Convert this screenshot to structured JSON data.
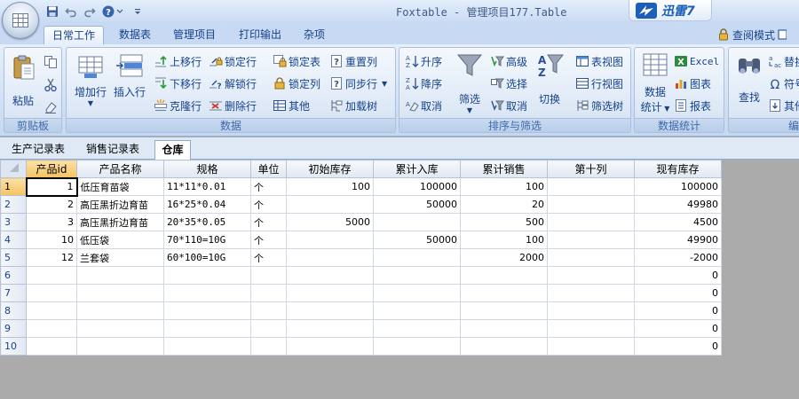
{
  "window": {
    "title": "Foxtable - 管理项目177.Table"
  },
  "brand": {
    "name": "迅雷7"
  },
  "quick_access": [
    {
      "icon": "save-icon"
    },
    {
      "icon": "undo-icon"
    },
    {
      "icon": "redo-icon"
    },
    {
      "icon": "help-icon"
    },
    {
      "icon": "customize-dropdown-icon"
    }
  ],
  "ribbon_tabs": [
    {
      "label": "日常工作",
      "active": true
    },
    {
      "label": "数据表"
    },
    {
      "label": "管理项目"
    },
    {
      "label": "打印输出"
    },
    {
      "label": "杂项"
    }
  ],
  "view_mode": {
    "label": "查阅模式"
  },
  "groups": {
    "clipboard": {
      "label": "剪贴板",
      "paste": "粘贴"
    },
    "data": {
      "label": "数据",
      "add_row": "增加行",
      "insert_row": "插入行",
      "move_up": "上移行",
      "move_down": "下移行",
      "clone_row": "克隆行",
      "lock_row": "锁定行",
      "unlock_row": "解锁行",
      "delete_row": "删除行",
      "lock_table": "锁定表",
      "lock_column": "锁定列",
      "other": "其他",
      "reset_column": "重置列",
      "sync_row": "同步行",
      "load_tree": "加载树"
    },
    "sort_filter": {
      "label": "排序与筛选",
      "asc": "升序",
      "desc": "降序",
      "cancel_sort": "取消",
      "filter": "筛选",
      "advanced": "高级",
      "select": "选择",
      "cancel_filter": "取消",
      "switch": "切换",
      "table_view": "表视图",
      "row_view": "行视图",
      "filter_tree": "筛选树"
    },
    "statistics": {
      "label": "数据统计",
      "data_stats_line1": "数据",
      "data_stats_line2": "统计",
      "excel": "Excel",
      "chart": "图表",
      "report": "报表"
    },
    "edit": {
      "label": "编辑",
      "find": "查找",
      "replace": "替换",
      "symbol": "符号",
      "other": "其他"
    }
  },
  "sheet_tabs": [
    {
      "label": "生产记录表"
    },
    {
      "label": "销售记录表"
    },
    {
      "label": "仓库",
      "active": true
    }
  ],
  "table": {
    "columns": [
      "产品id",
      "产品名称",
      "规格",
      "单位",
      "初始库存",
      "累计入库",
      "累计销售",
      "第十列",
      "现有库存"
    ],
    "rows": [
      {
        "num": "1",
        "cells": [
          "1",
          "低压育苗袋",
          "11*11*0.01",
          "个",
          "100",
          "100000",
          "100",
          "",
          "100000"
        ]
      },
      {
        "num": "2",
        "cells": [
          "2",
          "高压黑折边育苗",
          "16*25*0.04",
          "个",
          "",
          "50000",
          "20",
          "",
          "49980"
        ]
      },
      {
        "num": "3",
        "cells": [
          "3",
          "高压黑折边育苗",
          "20*35*0.05",
          "个",
          "5000",
          "",
          "500",
          "",
          "4500"
        ]
      },
      {
        "num": "4",
        "cells": [
          "10",
          "低压袋",
          "70*110=10G",
          "个",
          "",
          "50000",
          "100",
          "",
          "49900"
        ]
      },
      {
        "num": "5",
        "cells": [
          "12",
          "兰套袋",
          "60*100=10G",
          "个",
          "",
          "",
          "2000",
          "",
          "-2000"
        ]
      },
      {
        "num": "6",
        "cells": [
          "",
          "",
          "",
          "",
          "",
          "",
          "",
          "",
          "0"
        ]
      },
      {
        "num": "7",
        "cells": [
          "",
          "",
          "",
          "",
          "",
          "",
          "",
          "",
          "0"
        ]
      },
      {
        "num": "8",
        "cells": [
          "",
          "",
          "",
          "",
          "",
          "",
          "",
          "",
          "0"
        ]
      },
      {
        "num": "9",
        "cells": [
          "",
          "",
          "",
          "",
          "",
          "",
          "",
          "",
          "0"
        ]
      },
      {
        "num": "10",
        "cells": [
          "",
          "",
          "",
          "",
          "",
          "",
          "",
          "",
          "0"
        ]
      }
    ]
  }
}
